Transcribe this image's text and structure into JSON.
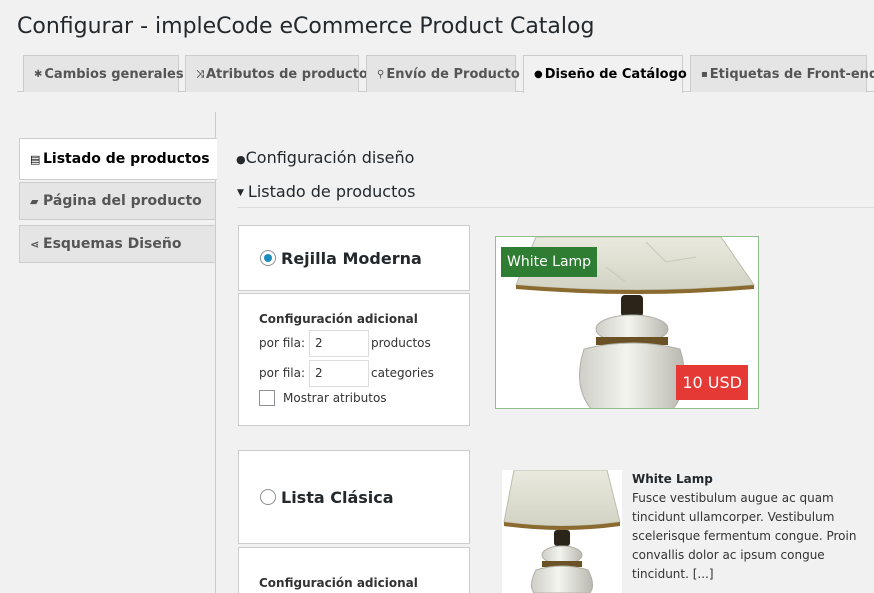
{
  "page_title": "Configurar - impleCode eCommerce Product Catalog",
  "tabs": [
    {
      "label": "Cambios generales",
      "icon": "gear-icon"
    },
    {
      "label": "Atributos de producto",
      "icon": "shuffle-icon"
    },
    {
      "label": "Envío de Producto",
      "icon": "map-pin-icon"
    },
    {
      "label": "Diseño de Catálogo",
      "icon": "palette-icon",
      "active": true
    },
    {
      "label": "Etiquetas de Front-end",
      "icon": "comment-icon"
    }
  ],
  "sidebar": {
    "items": [
      {
        "label": "Listado de productos",
        "icon": "list-icon",
        "active": true
      },
      {
        "label": "Página del producto",
        "icon": "page-icon"
      },
      {
        "label": "Esquemas Diseño",
        "icon": "share-icon"
      }
    ]
  },
  "main": {
    "section_title": "Configuración diseño",
    "subsection_title": "Listado de productos",
    "layouts": [
      {
        "label": "Rejilla Moderna",
        "selected": true,
        "settings_title": "Configuración adicional",
        "per_row_label": "por fila:",
        "products_value": "2",
        "products_unit": "productos",
        "categories_value": "2",
        "categories_unit": "categories",
        "show_attributes_label": "Mostrar atributos"
      },
      {
        "label": "Lista Clásica",
        "selected": false,
        "settings_title": "Configuración adicional"
      }
    ],
    "grid_preview": {
      "product_name": "White Lamp",
      "price": "10 USD"
    },
    "list_preview": {
      "product_name": "White Lamp",
      "description": "Fusce vestibulum augue ac quam tincidunt ullamcorper. Vestibulum scelerisque fermentum congue. Proin convallis dolor ac ipsum congue tincidunt. [...]"
    }
  },
  "colors": {
    "name_badge": "#2e7d32",
    "price_badge": "#e53935",
    "radio_accent": "#1e8cbe"
  }
}
